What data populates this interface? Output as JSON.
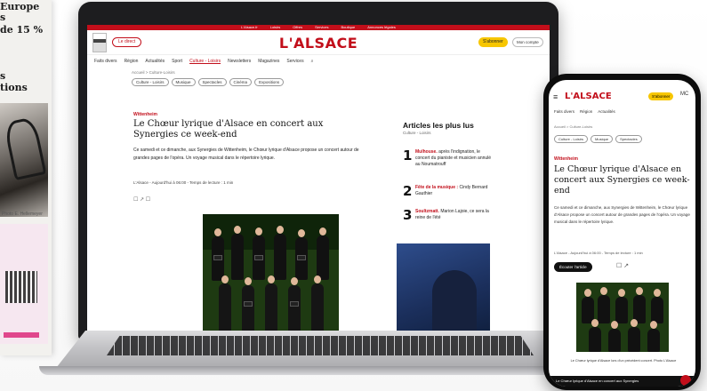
{
  "newspaper": {
    "headline_1": "Europe",
    "headline_2": "s",
    "headline_3": "de 15 %",
    "headline_4": "s",
    "headline_5": "tions",
    "photo_credit": "Photo E. Hellemeyer"
  },
  "site": {
    "logo": "L'ALSACE",
    "direct_label": "Le direct",
    "subscribe_label": "S'abonner",
    "account_label": "Mon compte",
    "top_links": [
      "L'Alsace.fr",
      "Loisirs",
      "Offres",
      "Services",
      "Boutique",
      "Annonces légales"
    ],
    "menu": [
      "Faits divers",
      "Région",
      "Actualités",
      "Sport",
      "Culture - Loisirs",
      "Newsletters",
      "Magazines",
      "Services"
    ],
    "menu_active_index": 4,
    "breadcrumb": "Accueil > Culture-Loisirs",
    "chips": [
      "Culture - Loisirs",
      "Musique",
      "Spectacles",
      "Cinéma",
      "Expositions"
    ]
  },
  "article": {
    "rubric": "Wittenheim",
    "title": "Le Chœur lyrique d'Alsace en concert aux Synergies ce week-end",
    "chapo": "Ce samedi et ce dimanche, aux Synergies de Wittenheim, le Chœur lyrique d'Alsace propose un concert autour de grandes pages de l'opéra. Un voyage musical dans le répertoire lyrique.",
    "byline": "L'Alsace - Aujourd'hui à 06:00 - Temps de lecture : 1 min",
    "share": "☐ ↗ ☐"
  },
  "aside": {
    "title": "Articles les plus lus",
    "subtitle": "Culture - Loisirs",
    "items": [
      {
        "num": "1",
        "kicker": "Mulhouse.",
        "text": "après l'indignation, le concert du pianiste et musicien annulé au Noumatrouff"
      },
      {
        "num": "2",
        "kicker": "Fête de la musique :",
        "text": "Cindy Bernard Gauthier"
      },
      {
        "num": "3",
        "kicker": "Soultzmatt.",
        "text": "Marion Lajoie, ce sera la reine de l'été"
      }
    ]
  },
  "phone": {
    "logo": "L'ALSACE",
    "subscribe_label": "S'abonner",
    "account_label": "MC",
    "menu": [
      "Faits divers",
      "Région",
      "Actualités"
    ],
    "breadcrumb": "Accueil > Culture-Loisirs",
    "chips": [
      "Culture - Loisirs",
      "Musique",
      "Spectacles"
    ],
    "rubric": "Wittenheim",
    "title": "Le Chœur lyrique d'Alsace en concert aux Synergies ce week-end",
    "chapo": "Ce samedi et ce dimanche, aux Synergies de Wittenheim, le Chœur lyrique d'Alsace propose un concert autour de grandes pages de l'opéra. Un voyage musical dans le répertoire lyrique.",
    "byline": "L'Alsace - Aujourd'hui à 06:00 - Temps de lecture : 1 min",
    "listen_label": "Écouter l'article",
    "icons": "☐ ↗",
    "caption": "Le Chœur lyrique d'Alsace lors d'un précédent concert. Photo L'Alsace",
    "bottom_text": "Le Chœur lyrique d'Alsace en concert aux Synergies"
  },
  "colors": {
    "brand_red": "#c20e1a",
    "subscribe_yellow": "#f7c600"
  }
}
